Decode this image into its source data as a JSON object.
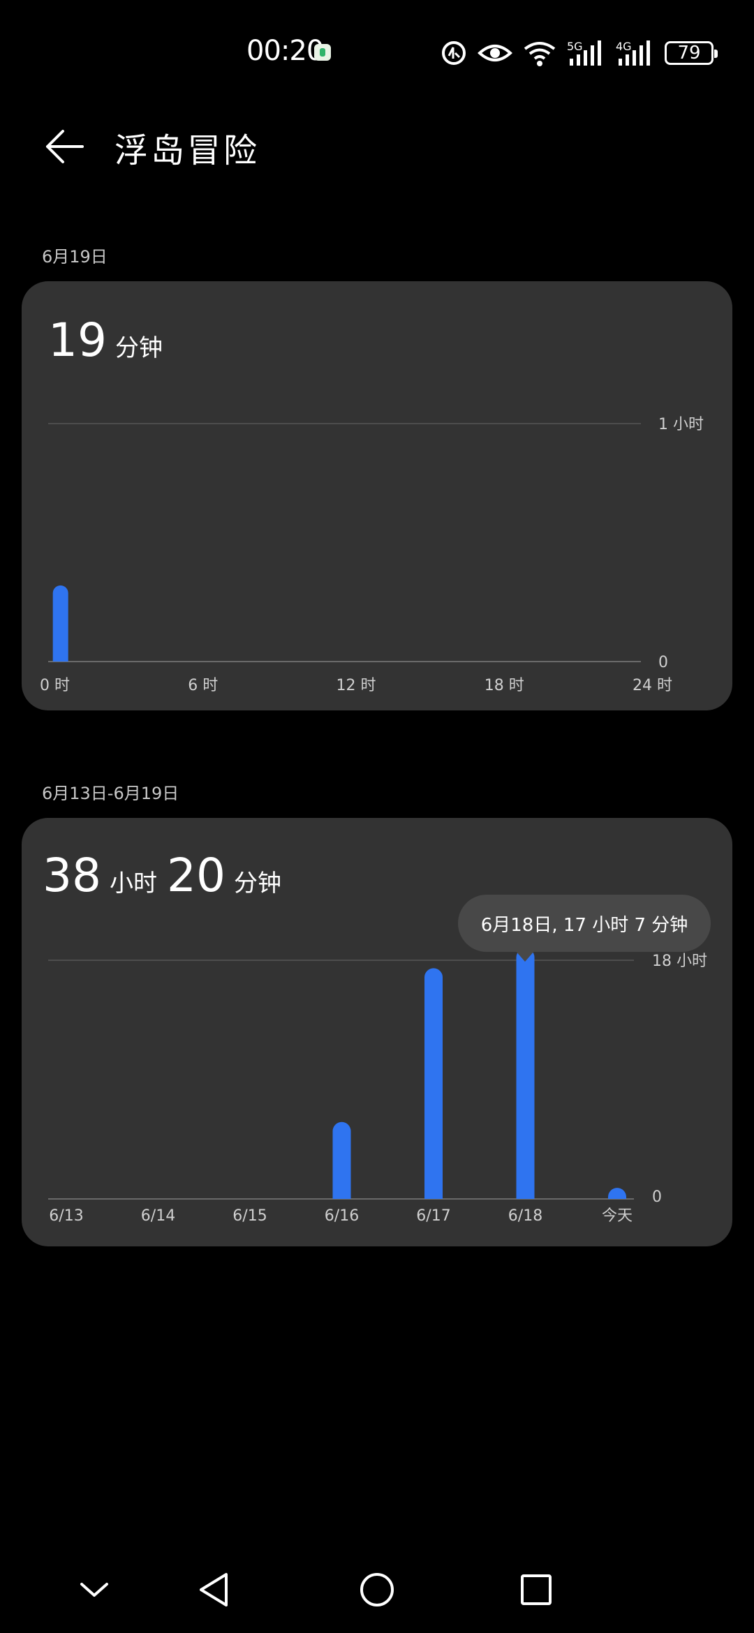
{
  "status_bar": {
    "time": "00:20",
    "signal_labels": [
      "5G",
      "4G"
    ],
    "battery": "79"
  },
  "header": {
    "title": "浮岛冒险"
  },
  "daily": {
    "date_label": "6月19日",
    "total_value": "19",
    "total_unit": "分钟"
  },
  "weekly": {
    "range_label": "6月13日-6月19日",
    "total_hours": "38",
    "hours_unit": "小时",
    "total_minutes": "20",
    "minutes_unit": "分钟",
    "tooltip": "6月18日, 17 小时 7 分钟"
  },
  "chart_data": [
    {
      "type": "bar",
      "title": "",
      "x": [
        "0 时",
        "6 时",
        "12 时",
        "18 时",
        "24 时"
      ],
      "x_ticks": [
        0,
        6,
        12,
        18,
        24
      ],
      "bars": [
        {
          "hour": 0.5,
          "value_hours": 0.32
        }
      ],
      "ylim": [
        0,
        1
      ],
      "y_tick_labels": [
        "0",
        "1 小时"
      ],
      "xlabel": "",
      "ylabel": "",
      "bar_color": "#2f74f0"
    },
    {
      "type": "bar",
      "title": "",
      "categories": [
        "6/13",
        "6/14",
        "6/15",
        "6/16",
        "6/17",
        "6/18",
        "今天"
      ],
      "values": [
        0,
        0,
        0,
        5.8,
        17.4,
        18.9,
        0.3
      ],
      "ylim": [
        0,
        20
      ],
      "reference_line": 18,
      "y_tick_labels": [
        "0",
        "18 小时"
      ],
      "xlabel": "",
      "ylabel": "",
      "bar_color": "#2f74f0"
    }
  ],
  "nav": {
    "icons": [
      "chevron-down-icon",
      "back-triangle-icon",
      "home-circle-icon",
      "recents-square-icon"
    ]
  }
}
